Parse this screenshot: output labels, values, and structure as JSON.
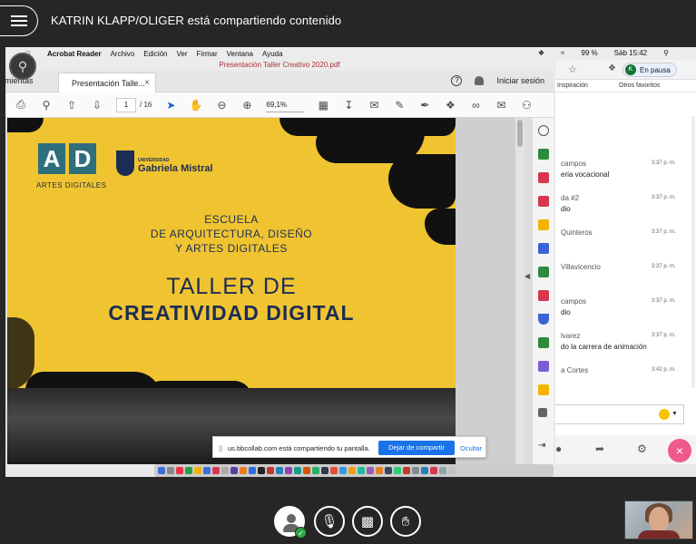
{
  "session": {
    "share_title": "KATRIN KLAPP/OLIGER está compartiendo contenido"
  },
  "macbar": {
    "app": "Acrobat Reader",
    "menus": [
      "Archivo",
      "Edición",
      "Ver",
      "Firmar",
      "Ventana",
      "Ayuda"
    ],
    "battery": "99 %",
    "clock": "Sáb 15:42"
  },
  "acrobat": {
    "window_title": "Presentación Taller Creativo 2020.pdf",
    "tools_tab": "amientas",
    "doc_tab": "Presentación Talle...",
    "signin": "Iniciar sesión",
    "page_current": "1",
    "page_total": "/ 16",
    "zoom": "69,1%"
  },
  "pdf": {
    "ad_letters": [
      "A",
      "D"
    ],
    "ad_label": "ARTES DIGITALES",
    "ugm_small": "UNIVERSIDAD",
    "ugm_big": "Gabriela Mistral",
    "school_lines": [
      "ESCUELA",
      "DE ARQUITECTURA, DISEÑO",
      "Y ARTES DIGITALES"
    ],
    "title_line1": "TALLER DE",
    "title_line2": "CREATIVIDAD DIGITAL"
  },
  "share_banner": {
    "message": "us.bbcollab.com está compartiendo tu pantalla.",
    "stop_label": "Dejar de compartir",
    "hide_label": "Ocultar"
  },
  "chrome": {
    "profile_initial": "K",
    "profile_status": "En pausa",
    "bookmark_1": "Inspiración",
    "bookmark_2": "Otros favoritos"
  },
  "chat": {
    "messages": [
      {
        "name": "campos",
        "time": "3:37 p. m.",
        "text": "eria vocacional"
      },
      {
        "name": "da #2",
        "time": "3:37 p. m.",
        "text": "dio"
      },
      {
        "name": "Quinteros",
        "time": "3:37 p. m.",
        "text": ""
      },
      {
        "name": "Villavicencio",
        "time": "3:37 p. m.",
        "text": ""
      },
      {
        "name": "campos",
        "time": "3:37 p. m.",
        "text": "dio"
      },
      {
        "name": "lvarez",
        "time": "3:37 p. m.",
        "text": "do la carrera de animación"
      },
      {
        "name": "a Cortes",
        "time": "3:42 p. m.",
        "text": ""
      }
    ]
  },
  "colors": {
    "pdf_yellow": "#f0c431",
    "navy": "#1d2c55",
    "teal": "#2f6e7b",
    "stop_blue": "#1a73e8",
    "leave_pink": "#f05a8a"
  }
}
